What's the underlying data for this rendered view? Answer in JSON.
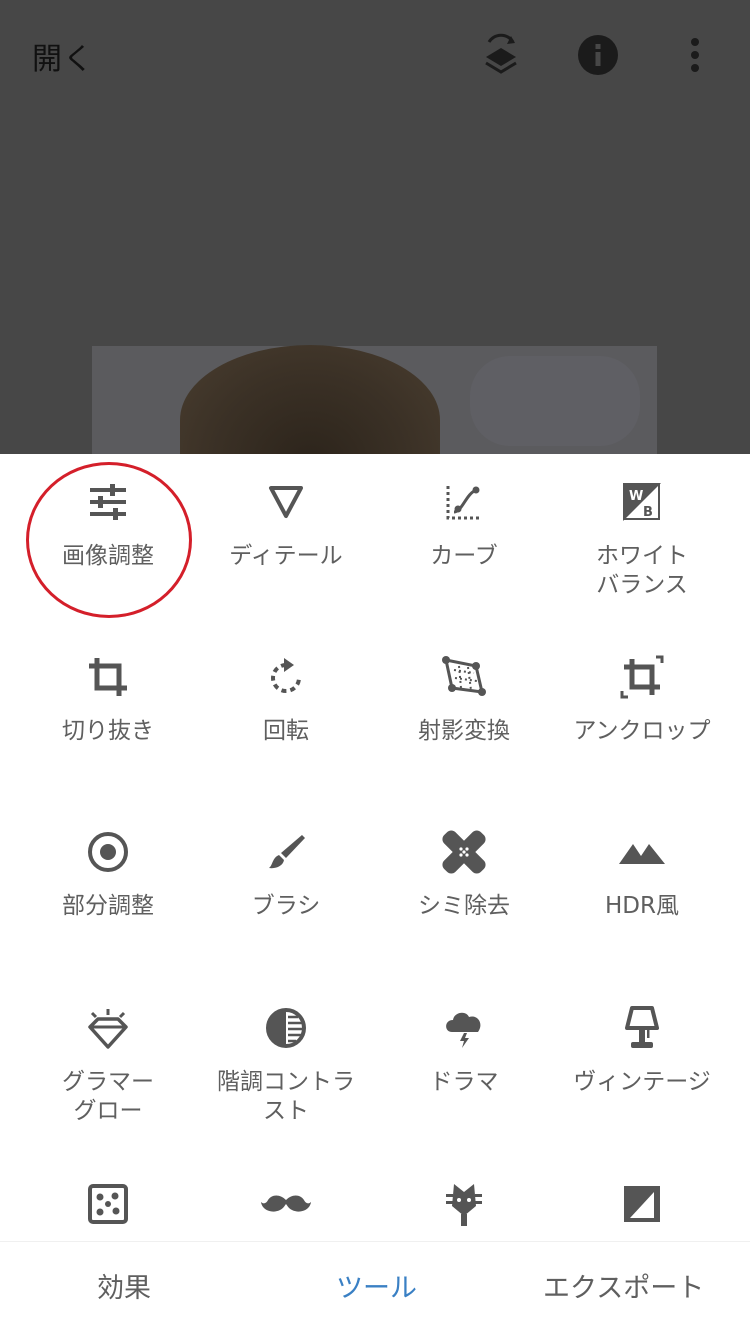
{
  "header": {
    "open_label": "開く",
    "icons": [
      "layers-history-icon",
      "info-icon",
      "more-vert-icon"
    ]
  },
  "tools": [
    {
      "label": "画像調整",
      "icon": "tune-sliders-icon",
      "highlighted": true
    },
    {
      "label": "ディテール",
      "icon": "triangle-detail-icon"
    },
    {
      "label": "カーブ",
      "icon": "curves-icon"
    },
    {
      "label": "ホワイト\nバランス",
      "icon": "white-balance-icon"
    },
    {
      "label": "切り抜き",
      "icon": "crop-icon"
    },
    {
      "label": "回転",
      "icon": "rotate-icon"
    },
    {
      "label": "射影変換",
      "icon": "perspective-icon"
    },
    {
      "label": "アンクロップ",
      "icon": "expand-icon"
    },
    {
      "label": "部分調整",
      "icon": "selective-adjust-icon"
    },
    {
      "label": "ブラシ",
      "icon": "brush-icon"
    },
    {
      "label": "シミ除去",
      "icon": "healing-bandage-icon"
    },
    {
      "label": "HDR風",
      "icon": "mountains-hdr-icon"
    },
    {
      "label": "グラマー\nグロー",
      "icon": "diamond-glow-icon"
    },
    {
      "label": "階調コントラ\nスト",
      "icon": "tonal-contrast-icon"
    },
    {
      "label": "ドラマ",
      "icon": "storm-cloud-icon"
    },
    {
      "label": "ヴィンテージ",
      "icon": "lamp-vintage-icon"
    },
    {
      "label": "",
      "icon": "grainy-film-icon"
    },
    {
      "label": "",
      "icon": "mustache-icon"
    },
    {
      "label": "",
      "icon": "guitar-head-icon"
    },
    {
      "label": "",
      "icon": "frames-icon"
    }
  ],
  "bottom_nav": {
    "effects": "効果",
    "tools": "ツール",
    "export": "エクスポート",
    "active": "tools",
    "active_color": "#3a80c4"
  },
  "colors": {
    "highlight_ring": "#d41f2a",
    "icon": "#555555",
    "label": "#5f5f5f"
  }
}
